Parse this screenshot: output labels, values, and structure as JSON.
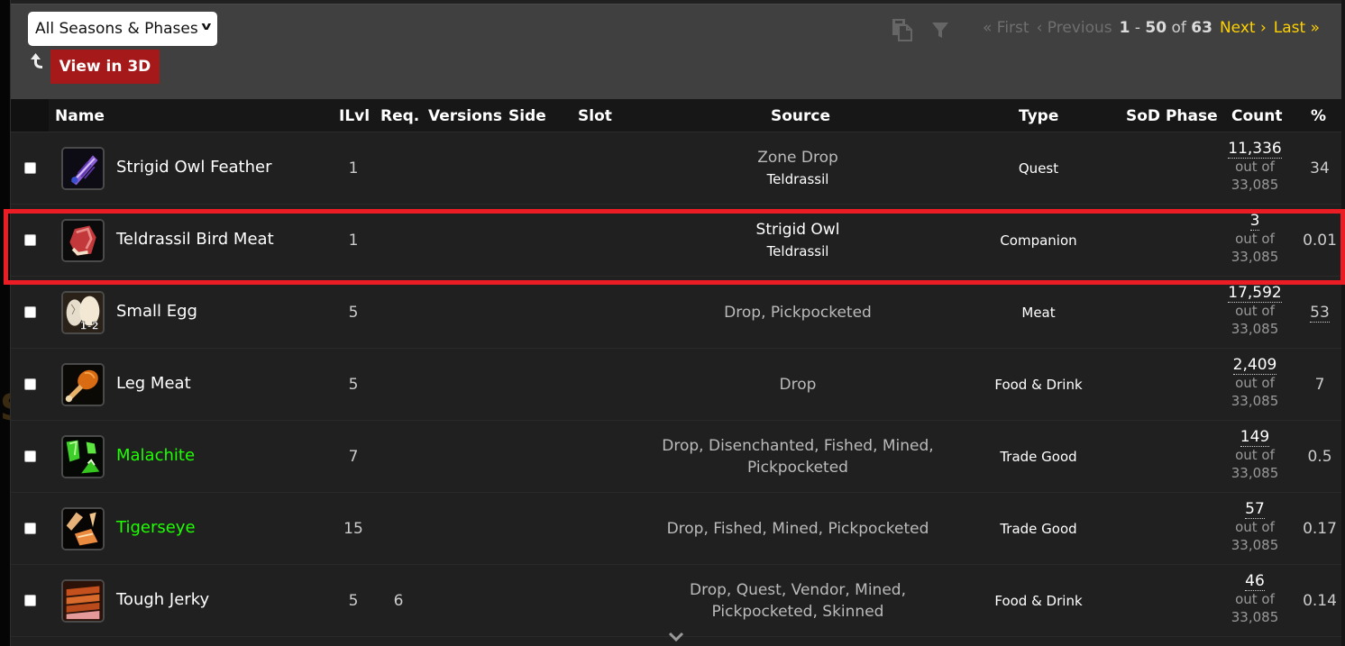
{
  "toolbar": {
    "season_select": {
      "value": "All Seasons & Phases"
    },
    "view_3d_label": "View in 3D",
    "icons": [
      "copy-icon",
      "filter-icon",
      "back-arrow-icon"
    ],
    "pager": {
      "first": "« First",
      "previous": "‹ Previous",
      "range_start": "1",
      "range_end": "50",
      "of": "of",
      "total": "63",
      "next": "Next ›",
      "last": "Last »"
    }
  },
  "table": {
    "columns": {
      "name": "Name",
      "ilvl": "ILvl",
      "req": "Req.",
      "versions": "Versions",
      "side": "Side",
      "slot": "Slot",
      "source": "Source",
      "type": "Type",
      "sod_phase": "SoD Phase",
      "count": "Count",
      "pct": "%"
    },
    "out_of_label": "out of",
    "rows": [
      {
        "name": "Strigid Owl Feather",
        "quality": "common",
        "icon": "feather-icon",
        "ilvl": "1",
        "req": "",
        "source": "Zone Drop",
        "source_zone": "Teldrassil",
        "type": "Quest",
        "count": "11,336",
        "out_of": "33,085",
        "pct": "34"
      },
      {
        "name": "Teldrassil Bird Meat",
        "quality": "common",
        "icon": "raw-meat-icon",
        "ilvl": "1",
        "req": "",
        "source": "Strigid Owl",
        "source_zone": "Teldrassil",
        "type": "Companion",
        "count": "3",
        "out_of": "33,085",
        "pct": "0.01",
        "highlighted": true
      },
      {
        "name": "Small Egg",
        "quality": "common",
        "icon": "egg-icon",
        "icon_stack": "1-2",
        "ilvl": "5",
        "req": "",
        "source": "Drop, Pickpocketed",
        "source_zone": "",
        "type": "Meat",
        "count": "17,592",
        "out_of": "33,085",
        "pct": "53"
      },
      {
        "name": "Leg Meat",
        "quality": "common",
        "icon": "drumstick-icon",
        "ilvl": "5",
        "req": "",
        "source": "Drop",
        "source_zone": "",
        "type": "Food & Drink",
        "count": "2,409",
        "out_of": "33,085",
        "pct": "7"
      },
      {
        "name": "Malachite",
        "quality": "uncommon",
        "icon": "green-gem-icon",
        "ilvl": "7",
        "req": "",
        "source": "Drop, Disenchanted, Fished, Mined, Pickpocketed",
        "source_zone": "",
        "type": "Trade Good",
        "count": "149",
        "out_of": "33,085",
        "pct": "0.5"
      },
      {
        "name": "Tigerseye",
        "quality": "uncommon",
        "icon": "orange-gem-icon",
        "ilvl": "15",
        "req": "",
        "source": "Drop, Fished, Mined, Pickpocketed",
        "source_zone": "",
        "type": "Trade Good",
        "count": "57",
        "out_of": "33,085",
        "pct": "0.17"
      },
      {
        "name": "Tough Jerky",
        "quality": "common",
        "icon": "jerky-icon",
        "ilvl": "5",
        "req": "6",
        "source": "Drop, Quest, Vendor, Mined, Pickpocketed, Skinned",
        "source_zone": "",
        "type": "Food & Drink",
        "count": "46",
        "out_of": "33,085",
        "pct": "0.14"
      }
    ]
  },
  "colors": {
    "highlight_border": "#ec1c24",
    "pager_link": "#ffd100",
    "uncommon_quality": "#1eff00",
    "view_3d_bg": "#a5191a"
  }
}
